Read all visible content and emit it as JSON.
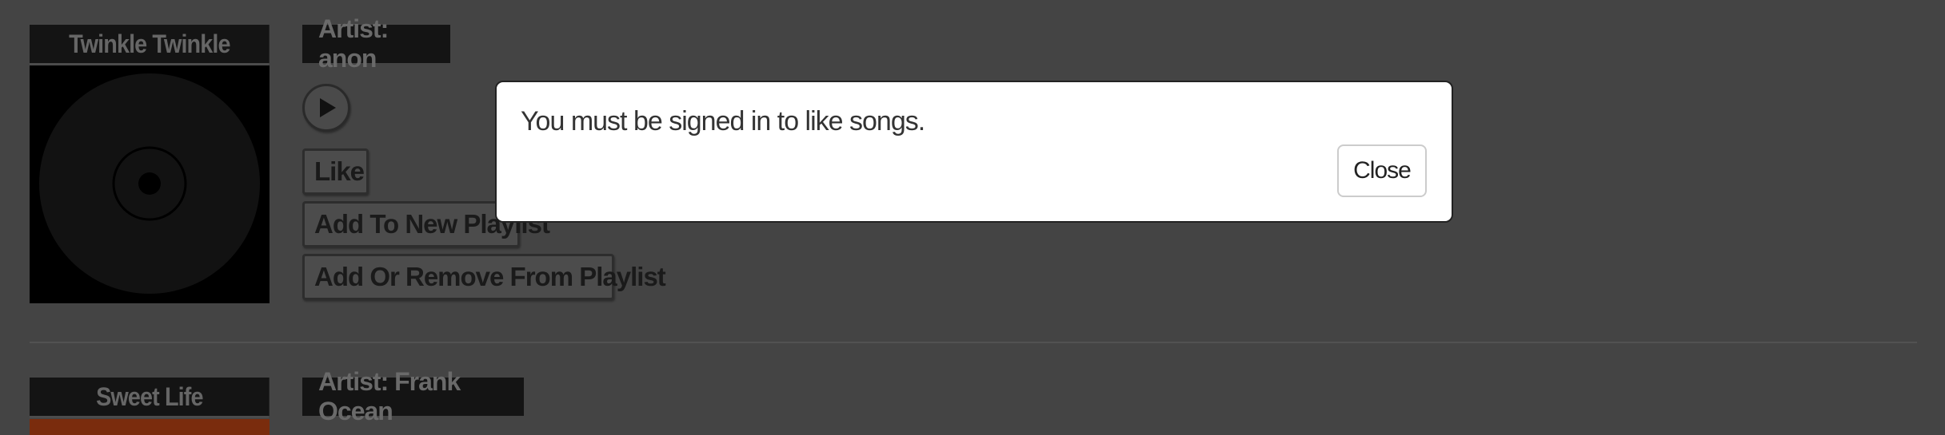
{
  "songs": [
    {
      "title": "Twinkle Twinkle",
      "artist": "Artist: anon",
      "buttons": {
        "like": "Like",
        "add_new_playlist": "Add To New Playlist",
        "add_remove_playlist": "Add Or Remove From Playlist"
      },
      "cover_icon": "vinyl-disc-icon",
      "play_icon": "play-icon"
    },
    {
      "title": "Sweet Life",
      "artist": "Artist: Frank Ocean"
    }
  ],
  "modal": {
    "message": "You must be signed in to like songs.",
    "close_label": "Close"
  },
  "colors": {
    "background": "#444444",
    "label_bg": "#141414",
    "modal_bg": "#ffffff",
    "cover2_accent": "#7a2c0d"
  }
}
